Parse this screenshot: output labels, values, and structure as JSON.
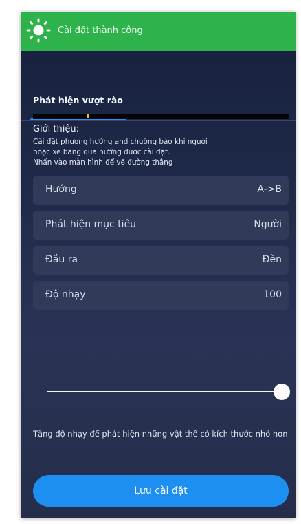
{
  "toast": {
    "icon": "sun-icon",
    "message": "Cài đặt thành công",
    "color": "#2eb24c"
  },
  "tab": {
    "label": "Phát hiện vượt rào",
    "indicator_color": "#1e90ff"
  },
  "intro": {
    "title": "Giới thiệu:",
    "lines": [
      "Cài đặt phương hướng and chuông báo khi người",
      "hoặc xe băng qua hướng được cài đặt.",
      "Nhấn vào màn hình để vẽ đường thẳng"
    ]
  },
  "settings": [
    {
      "label": "Hướng",
      "value": "A->B"
    },
    {
      "label": "Phát hiện mục tiêu",
      "value": "Người"
    },
    {
      "label": "Đầu ra",
      "value": "Đèn"
    },
    {
      "label": "Độ nhạy",
      "value": "100"
    }
  ],
  "sensitivity_slider": {
    "level_percent": 100
  },
  "hint": "Tăng độ nhạy để phát hiện những vật thể có kích thước nhỏ hơn",
  "save_button": {
    "label": "Lưu cài đặt",
    "color": "#1d8ff0"
  }
}
